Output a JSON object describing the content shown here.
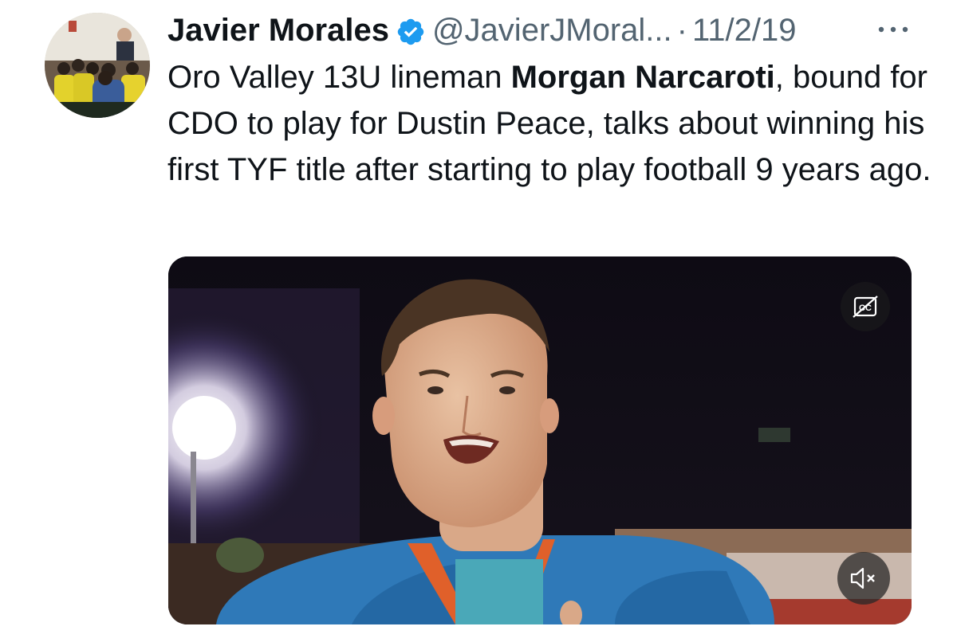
{
  "tweet": {
    "display_name": "Javier Morales",
    "handle": "@JavierJMoral...",
    "separator": "·",
    "date": "11/2/19",
    "text_before_mention": "Oro Valley 13U lineman ",
    "mention": "Morgan Narcaroti",
    "text_after_mention": ", bound for CDO to play for Dustin Peace, talks about winning his first TYF title after starting to play football 9 years ago.",
    "verified": true
  },
  "icons": {
    "verified": "verified-badge-icon",
    "more": "more-options-icon",
    "captions": "captions-off-icon",
    "mute": "volume-muted-icon"
  },
  "colors": {
    "verified_blue": "#1d9bf0",
    "secondary_text": "#536471",
    "primary_text": "#0f1419"
  }
}
